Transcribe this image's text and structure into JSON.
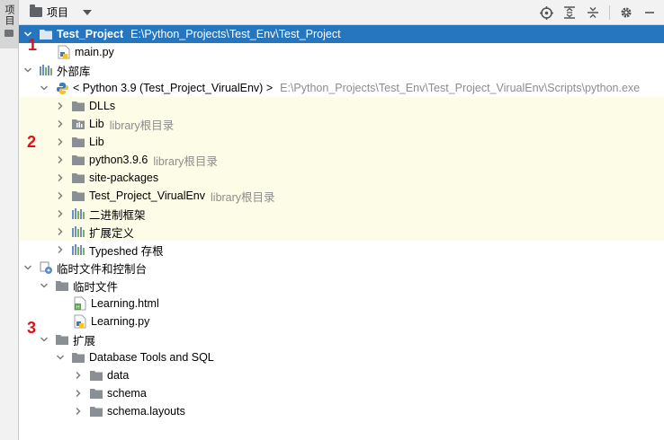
{
  "side_tab": {
    "label": "项目"
  },
  "toolbar": {
    "title": "项目",
    "icons": [
      "locate-icon",
      "expand-all-icon",
      "collapse-all-icon",
      "gear-icon",
      "minimize-icon"
    ]
  },
  "tree": {
    "project": {
      "name": "Test_Project",
      "path": "E:\\Python_Projects\\Test_Env\\Test_Project"
    },
    "main_py": "main.py",
    "ext_libs": "外部库",
    "python_sdk": {
      "name": "< Python 3.9 (Test_Project_VirualEnv) >",
      "path": "E:\\Python_Projects\\Test_Env\\Test_Project_VirualEnv\\Scripts\\python.exe"
    },
    "sdk_children": [
      {
        "name": "DLLs",
        "hint": ""
      },
      {
        "name": "Lib",
        "hint": "library根目录"
      },
      {
        "name": "Lib",
        "hint": ""
      },
      {
        "name": "python3.9.6",
        "hint": "library根目录"
      },
      {
        "name": "site-packages",
        "hint": ""
      },
      {
        "name": "Test_Project_VirualEnv",
        "hint": "library根目录"
      },
      {
        "name": "二进制框架",
        "hint": ""
      },
      {
        "name": "扩展定义",
        "hint": ""
      },
      {
        "name": "Typeshed 存根",
        "hint": ""
      }
    ],
    "scratches": "临时文件和控制台",
    "scratch_files": "临时文件",
    "learning_html": "Learning.html",
    "learning_py": "Learning.py",
    "extensions": "扩展",
    "db_tools": "Database Tools and SQL",
    "db_children": [
      "data",
      "schema",
      "schema.layouts"
    ]
  },
  "annotations": [
    "1",
    "2",
    "3"
  ],
  "colors": {
    "selection": "#2675bf",
    "highlight": "#fdfde7",
    "annotation": "#e0101a",
    "folder": "#8a8f95"
  }
}
